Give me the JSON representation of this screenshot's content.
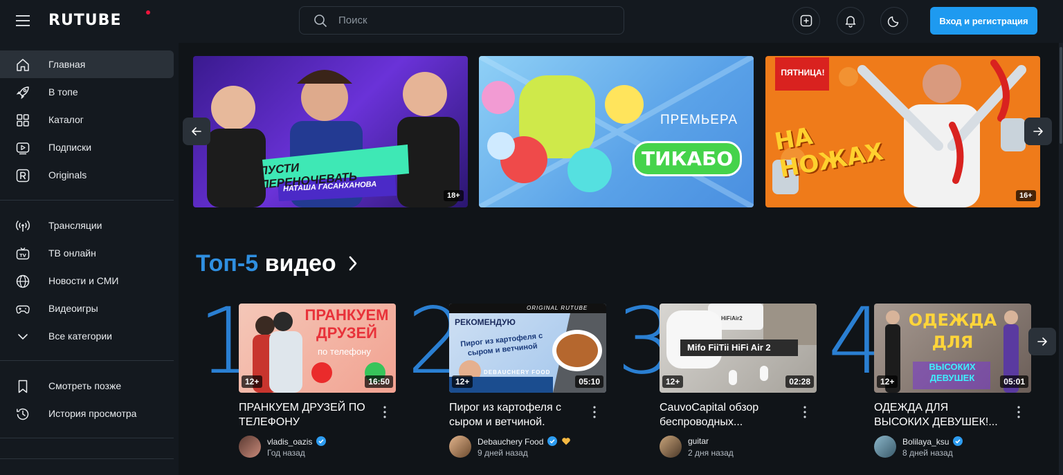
{
  "header": {
    "logo": "RUTUBE",
    "search_placeholder": "Поиск",
    "login_label": "Вход и регистрация"
  },
  "sidebar": {
    "items": [
      {
        "label": "Главная",
        "icon": "home-icon",
        "active": true
      },
      {
        "label": "В топе",
        "icon": "rocket-icon"
      },
      {
        "label": "Каталог",
        "icon": "grid-icon"
      },
      {
        "label": "Подписки",
        "icon": "subscriptions-icon"
      },
      {
        "label": "Originals",
        "icon": "originals-icon"
      },
      {
        "label": "Трансляции",
        "icon": "broadcast-icon"
      },
      {
        "label": "ТВ онлайн",
        "icon": "tv-icon"
      },
      {
        "label": "Новости и СМИ",
        "icon": "globe-icon"
      },
      {
        "label": "Видеоигры",
        "icon": "gamepad-icon"
      },
      {
        "label": "Все категории",
        "icon": "chevron-down-icon"
      },
      {
        "label": "Смотреть позже",
        "icon": "bookmark-icon"
      },
      {
        "label": "История просмотра",
        "icon": "history-icon"
      }
    ]
  },
  "banners": [
    {
      "title": "ПУСТИ ПЕРЕНОЧЕВАТЬ",
      "subtitle": "НАТАША ГАСАНХАНОВА",
      "age": "18+",
      "bg": "#5b2ec9"
    },
    {
      "title": "ТИКАБО",
      "subtitle": "ПРЕМЬЕРА",
      "bg": "#6fb4ec"
    },
    {
      "title": "НА НОЖАХ",
      "subtitle": "ПЯТНИЦА!",
      "age": "16+",
      "bg": "#ef7b1a"
    }
  ],
  "section": {
    "title_accent": "Топ-5",
    "title_rest": "видео"
  },
  "videos": [
    {
      "rank": "1",
      "thumb_text": "ПРАНКУЕМ ДРУЗЕЙ",
      "thumb_sub": "по телефону",
      "age": "12+",
      "duration": "16:50",
      "title": "ПРАНКУЕМ ДРУЗЕЙ ПО ТЕЛЕФОНУ",
      "channel": "vladis_oazis",
      "date": "Год назад"
    },
    {
      "rank": "2",
      "thumb_text": "РЕКОМЕНДУЮ",
      "thumb_sub": "Пирог из картофеля с сыром и ветчиной",
      "thumb_brand": "ORIGINAL RUTUBE",
      "thumb_footer": "DEBAUCHERY FOOD",
      "age": "12+",
      "duration": "05:10",
      "title": "Пирог из картофеля с сыром и ветчиной.",
      "channel": "Debauchery Food",
      "date": "9 дней назад"
    },
    {
      "rank": "3",
      "thumb_text": "Mifo FiiTii HiFi Air 2",
      "thumb_sub": "HiFiAir2",
      "age": "12+",
      "duration": "02:28",
      "title": "CauvoCapital обзор беспроводных...",
      "channel": "guitar",
      "date": "2 дня назад"
    },
    {
      "rank": "4",
      "thumb_text": "ОДЕЖДА ДЛЯ",
      "thumb_sub": "ВЫСОКИХ ДЕВУШЕК",
      "age": "12+",
      "duration": "05:01",
      "title": "ОДЕЖДА ДЛЯ ВЫСОКИХ ДЕВУШЕК!...",
      "channel": "Bolilaya_ksu",
      "date": "8 дней назад"
    }
  ],
  "colors": {
    "accent": "#1e9af0",
    "rank": "#2a7fd2",
    "bg": "#14191f"
  }
}
